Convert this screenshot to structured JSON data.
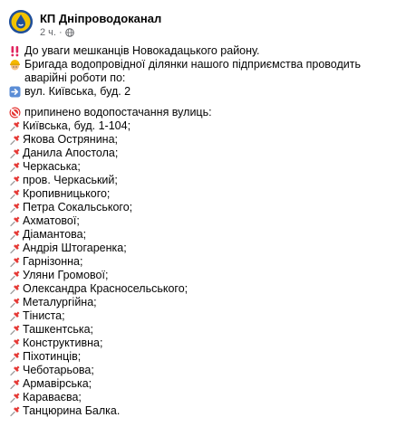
{
  "post": {
    "page_name": "КП Дніпроводоканал",
    "time": "2 ч.",
    "separator": "·",
    "lines": [
      "До уваги мешканців Новокадацького району.",
      "Бригада водопровідної ділянки нашого підприємства проводить аварійні роботи по:",
      "вул. Київська, буд. 2",
      "припинено водопостачання вулиць:"
    ],
    "streets": [
      "Київська, буд. 1-104;",
      "Якова Острянина;",
      "Данила Апостола;",
      "Черкаська;",
      "пров. Черкаський;",
      "Кропивницького;",
      "Петра Сокальського;",
      "Ахматової;",
      "Діамантова;",
      "Андрія Штогаренка;",
      "Гарнізонна;",
      "Уляни Громової;",
      "Олександра Красносельського;",
      "Металургійна;",
      "Тіниста;",
      "Ташкентська;",
      "Конструктивна;",
      "Піхотинців;",
      "Чеботарьова;",
      "Армавірська;",
      "Караваєва;",
      "Танцюрина Балка."
    ],
    "icons": {
      "avatar": "dniprovodokanal-logo",
      "audience": "globe-icon",
      "alert": "double-exclamation-icon",
      "worker": "construction-worker-icon",
      "arrow": "right-arrow-icon",
      "stop": "no-entry-icon",
      "pin": "pushpin-icon"
    },
    "colors": {
      "text": "#050505",
      "secondary": "#65676b",
      "alert": "#e0245e",
      "pin": "#e53935"
    }
  }
}
